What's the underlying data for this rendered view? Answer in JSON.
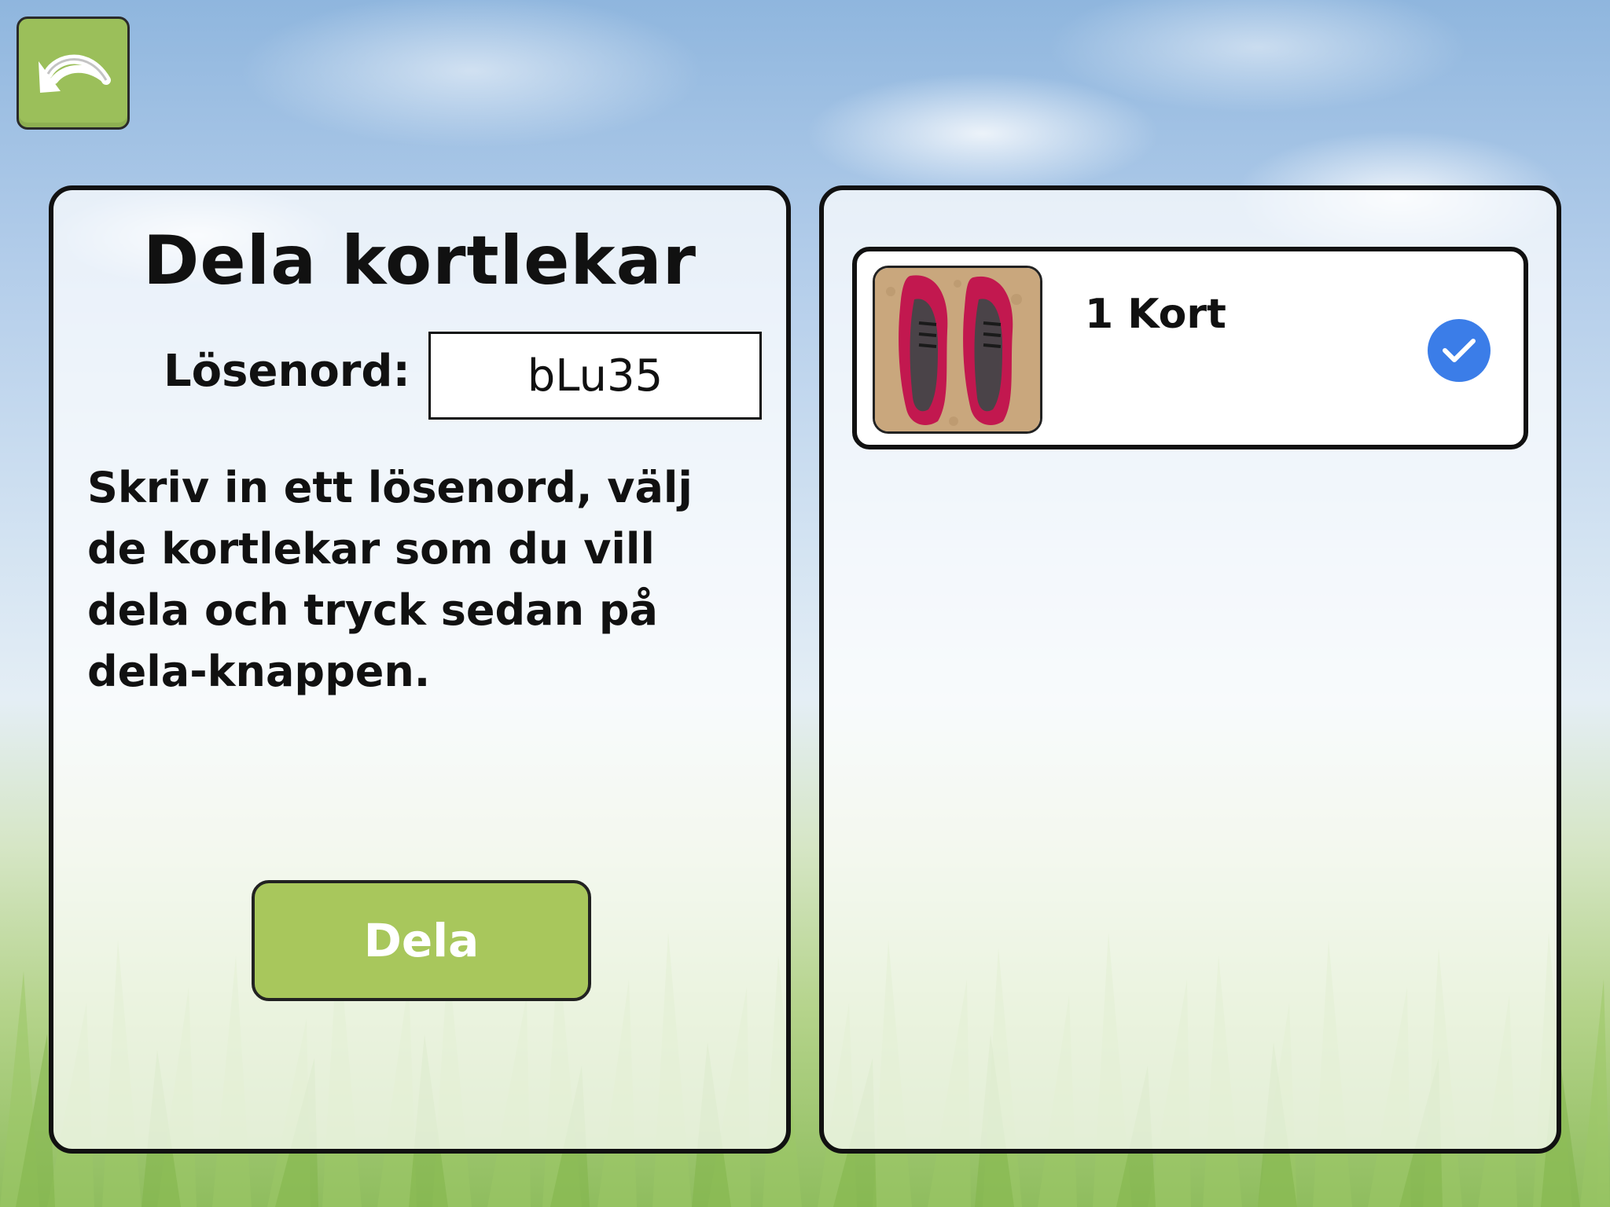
{
  "share": {
    "title": "Dela kortlekar",
    "password_label": "Lösenord:",
    "password_value": "bLu35",
    "instructions": "Skriv in ett lösenord, välj de kortlekar som du vill dela och tryck sedan på dela-knappen.",
    "share_button": "Dela"
  },
  "decks": [
    {
      "count_label": "1 Kort",
      "selected": true,
      "thumbnail": "sneakers-photo"
    }
  ],
  "colors": {
    "button_green": "#a8c75c",
    "check_blue": "#3b7de8"
  }
}
